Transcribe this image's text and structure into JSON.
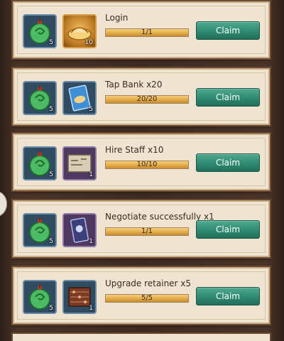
{
  "tasks": [
    {
      "title": "Login",
      "reward1": {
        "icon": "jade-pendant-icon",
        "qty": "5"
      },
      "reward2": {
        "icon": "gold-ingot-icon",
        "qty": "10"
      },
      "progress_text": "1/1",
      "progress": 1.0,
      "claim_label": "Claim"
    },
    {
      "title": "Tap Bank x20",
      "reward1": {
        "icon": "jade-pendant-icon",
        "qty": "5"
      },
      "reward2": {
        "icon": "blue-card-icon",
        "qty": "5"
      },
      "progress_text": "20/20",
      "progress": 1.0,
      "claim_label": "Claim"
    },
    {
      "title": "Hire Staff x10",
      "reward1": {
        "icon": "jade-pendant-icon",
        "qty": "5"
      },
      "reward2": {
        "icon": "scroll-map-icon",
        "qty": "1"
      },
      "progress_text": "10/10",
      "progress": 1.0,
      "claim_label": "Claim"
    },
    {
      "title": "Negotiate successfully x1",
      "reward1": {
        "icon": "jade-pendant-icon",
        "qty": "5"
      },
      "reward2": {
        "icon": "purple-talisman-icon",
        "qty": "1"
      },
      "progress_text": "1/1",
      "progress": 1.0,
      "claim_label": "Claim"
    },
    {
      "title": "Upgrade retainer x5",
      "reward1": {
        "icon": "jade-pendant-icon",
        "qty": "5"
      },
      "reward2": {
        "icon": "abacus-icon",
        "qty": "1"
      },
      "progress_text": "5/5",
      "progress": 1.0,
      "claim_label": "Claim"
    }
  ],
  "colors": {
    "card_bg": "#efe4d2",
    "claim_green": "#2e8a71",
    "progress_gold": "#e0a845"
  }
}
